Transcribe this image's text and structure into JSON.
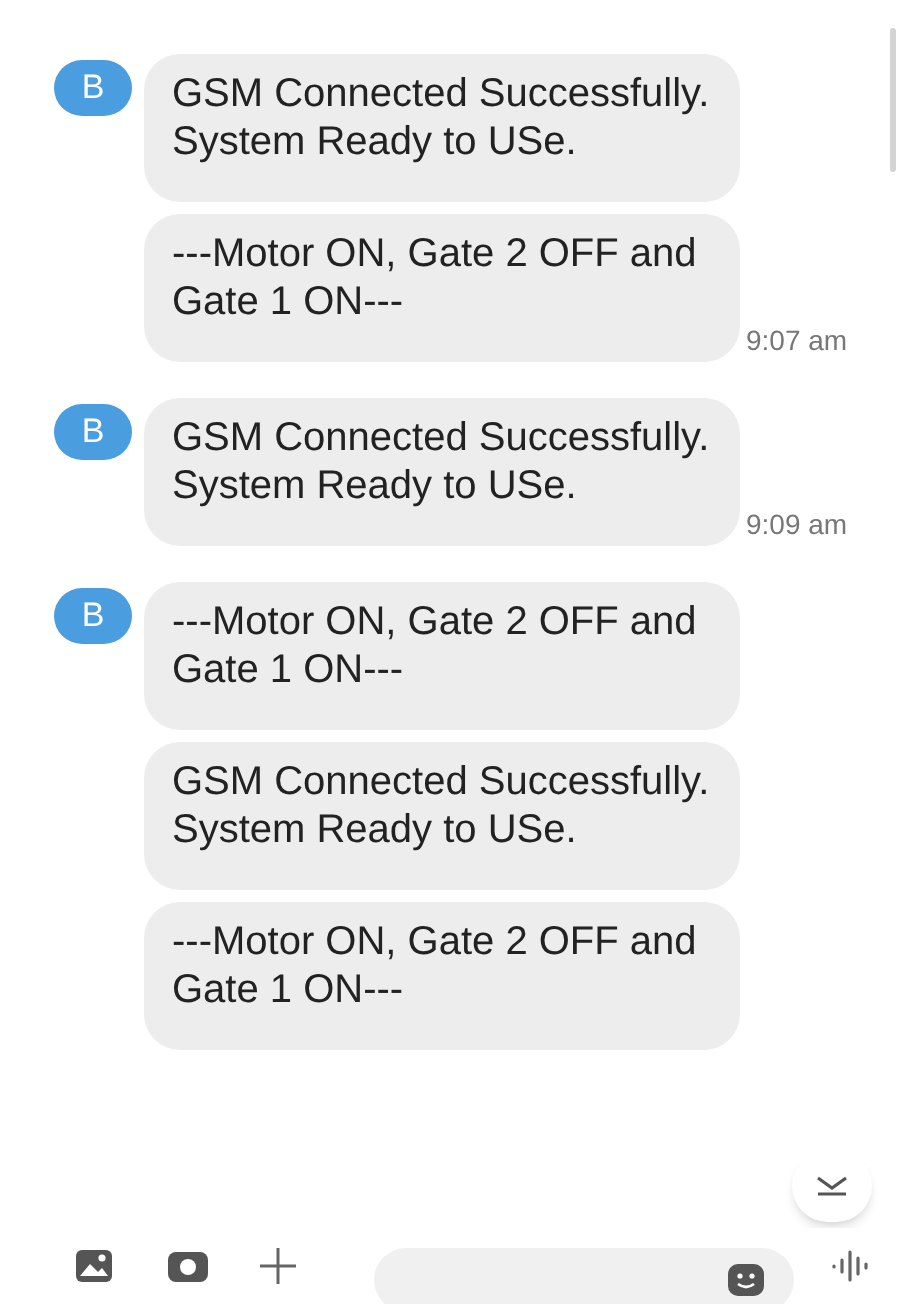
{
  "conversation": [
    {
      "avatar": "B",
      "messages": [
        "GSM Connected Successfully. System Ready to USe.",
        "---Motor ON, Gate 2 OFF and Gate 1 ON---"
      ],
      "time": "9:07 am"
    },
    {
      "avatar": "B",
      "messages": [
        "GSM Connected Successfully. System Ready to USe."
      ],
      "time": "9:09 am"
    },
    {
      "avatar": "B",
      "messages": [
        "---Motor ON, Gate 2 OFF and Gate 1 ON---",
        "GSM Connected Successfully. System Ready to USe.",
        "---Motor ON, Gate 2 OFF and Gate 1 ON---"
      ]
    }
  ]
}
